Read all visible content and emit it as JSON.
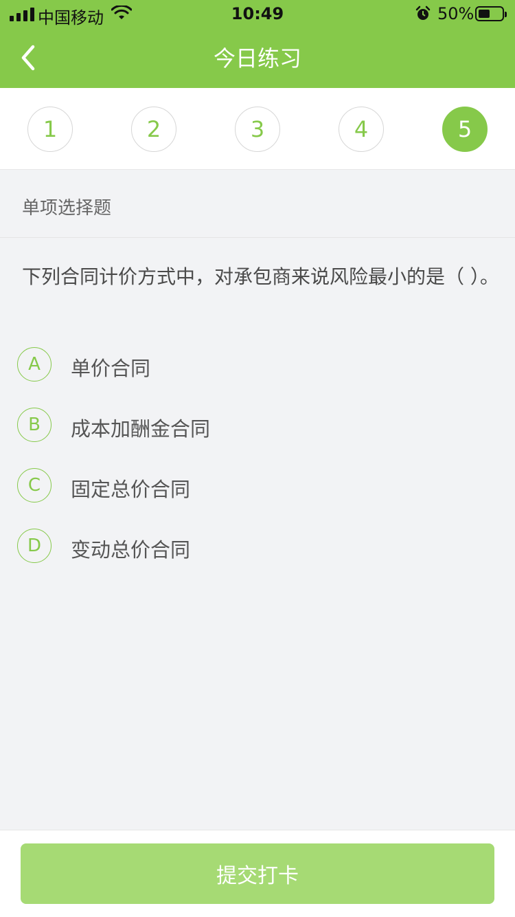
{
  "status_bar": {
    "carrier": "中国移动",
    "time": "10:49",
    "battery": "50%",
    "battery_level": 0.5
  },
  "nav": {
    "title": "今日练习",
    "back_icon": "chevron-left-icon"
  },
  "steps": [
    {
      "label": "1",
      "active": false
    },
    {
      "label": "2",
      "active": false
    },
    {
      "label": "3",
      "active": false
    },
    {
      "label": "4",
      "active": false
    },
    {
      "label": "5",
      "active": true
    }
  ],
  "section": {
    "label": "单项选择题"
  },
  "question": {
    "text": "下列合同计价方式中，对承包商来说风险最小的是（ ）。",
    "options": [
      {
        "letter": "A",
        "text": "单价合同"
      },
      {
        "letter": "B",
        "text": "成本加酬金合同"
      },
      {
        "letter": "C",
        "text": "固定总价合同"
      },
      {
        "letter": "D",
        "text": "变动总价合同"
      }
    ]
  },
  "footer": {
    "submit_label": "提交打卡"
  },
  "colors": {
    "accent": "#86c94a",
    "submit_disabled": "#a6da74",
    "background": "#f2f3f5"
  }
}
